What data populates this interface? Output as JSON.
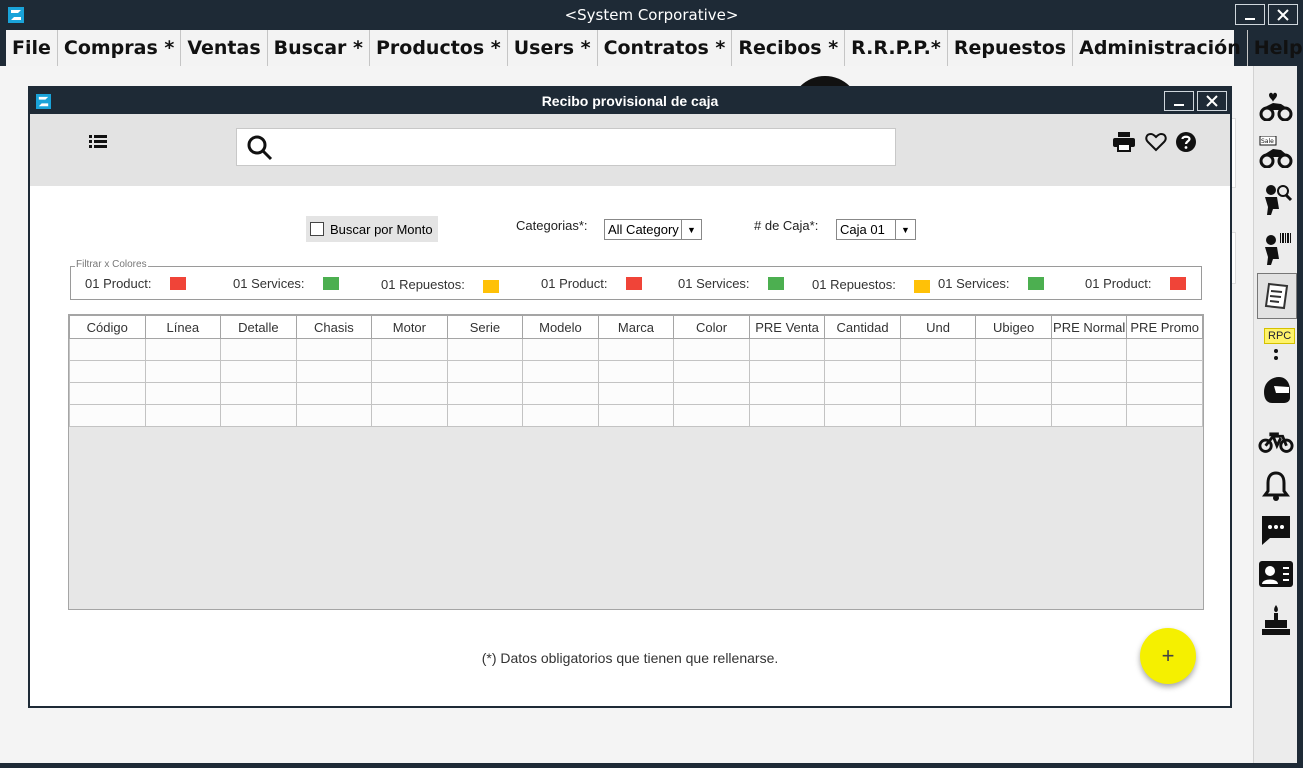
{
  "window": {
    "title": "<System Corporative>"
  },
  "menu": [
    "File",
    "Compras *",
    "Ventas",
    "Buscar *",
    "Productos *",
    "Users *",
    "Contratos *",
    "Recibos *",
    "R.R.P.P.*",
    "Repuestos",
    "Administración",
    "Help *"
  ],
  "sidebar": {
    "items": [
      "atv-heart-icon",
      "atv-sale-icon",
      "rider-search-icon",
      "rider-barcode-icon",
      "receipt-icon",
      "person-question-icon",
      "helmet-icon",
      "motorcycle-icon",
      "bell-icon",
      "chat-icon",
      "contact-card-icon",
      "birthday-cake-icon"
    ],
    "badge": "RPC"
  },
  "dialog": {
    "title": "Recibo provisional de caja",
    "search_placeholder": "",
    "checkbox_label": "Buscar por Monto",
    "category_label": "Categorias*:",
    "category_value": "All Category",
    "caja_label": "# de Caja*:",
    "caja_value": "Caja 01",
    "color_filter_legend": "Filtrar x Colores",
    "color_chips": [
      {
        "label": "01 Product:",
        "color": "#f04438"
      },
      {
        "label": "01 Services:",
        "color": "#4caf50"
      },
      {
        "label": "01 Repuestos:",
        "color": "#ffc107"
      },
      {
        "label": "01 Product:",
        "color": "#f04438"
      },
      {
        "label": "01 Services:",
        "color": "#4caf50"
      },
      {
        "label": "01 Repuestos:",
        "color": "#ffc107"
      },
      {
        "label": "01 Services:",
        "color": "#4caf50"
      },
      {
        "label": "01 Product:",
        "color": "#f04438"
      }
    ],
    "table_headers": [
      "Código",
      "Línea",
      "Detalle",
      "Chasis",
      "Motor",
      "Serie",
      "Modelo",
      "Marca",
      "Color",
      "PRE Venta",
      "Cantidad",
      "Und",
      "Ubigeo",
      "PRE Normal",
      "PRE Promo"
    ],
    "footnote": "(*) Datos obligatorios que tienen que rellenarse.",
    "fab_label": "+"
  },
  "colors": {
    "frame": "#1e2a36",
    "fab": "#f5f000"
  }
}
